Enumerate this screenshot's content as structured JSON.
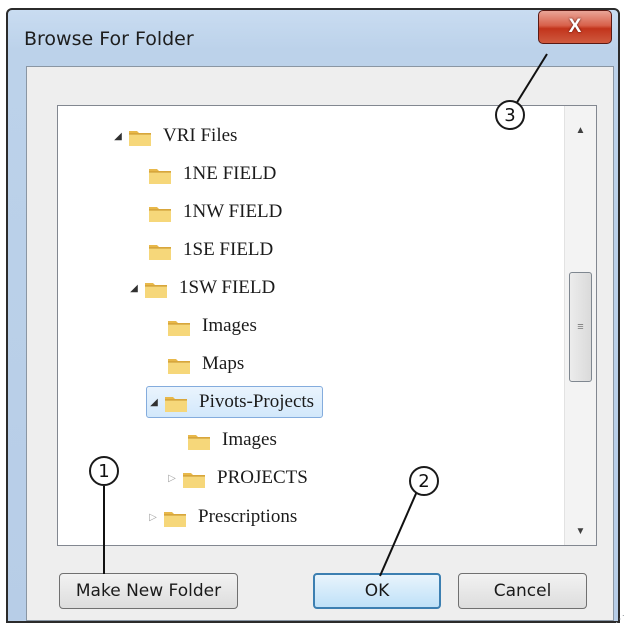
{
  "window": {
    "title": "Browse For Folder",
    "close_label": "X"
  },
  "tree": {
    "items": [
      {
        "label": "VRI Files",
        "expander": "◢",
        "state": "open"
      },
      {
        "label": "1NE FIELD",
        "expander": "",
        "state": "none"
      },
      {
        "label": "1NW FIELD",
        "expander": "",
        "state": "none"
      },
      {
        "label": "1SE FIELD",
        "expander": "",
        "state": "none"
      },
      {
        "label": "1SW FIELD",
        "expander": "◢",
        "state": "open"
      },
      {
        "label": "Images",
        "expander": "",
        "state": "none"
      },
      {
        "label": "Maps",
        "expander": "",
        "state": "none"
      },
      {
        "label": "Pivots-Projects",
        "expander": "◢",
        "state": "open",
        "selected": true
      },
      {
        "label": "Images",
        "expander": "",
        "state": "none"
      },
      {
        "label": "PROJECTS",
        "expander": "▷",
        "state": "closed"
      },
      {
        "label": "Prescriptions",
        "expander": "▷",
        "state": "closed"
      }
    ],
    "scroll_up": "▲",
    "scroll_down": "▼",
    "thumb_grip": "≡"
  },
  "buttons": {
    "make_new_folder": "Make New Folder",
    "ok": "OK",
    "cancel": "Cancel"
  },
  "callouts": {
    "one": "1",
    "two": "2",
    "three": "3"
  },
  "colors": {
    "title_bar": "#bcd2ea",
    "close_button": "#c2341c",
    "selection": "#d2e8fb",
    "default_button_border": "#3c7fb1"
  }
}
